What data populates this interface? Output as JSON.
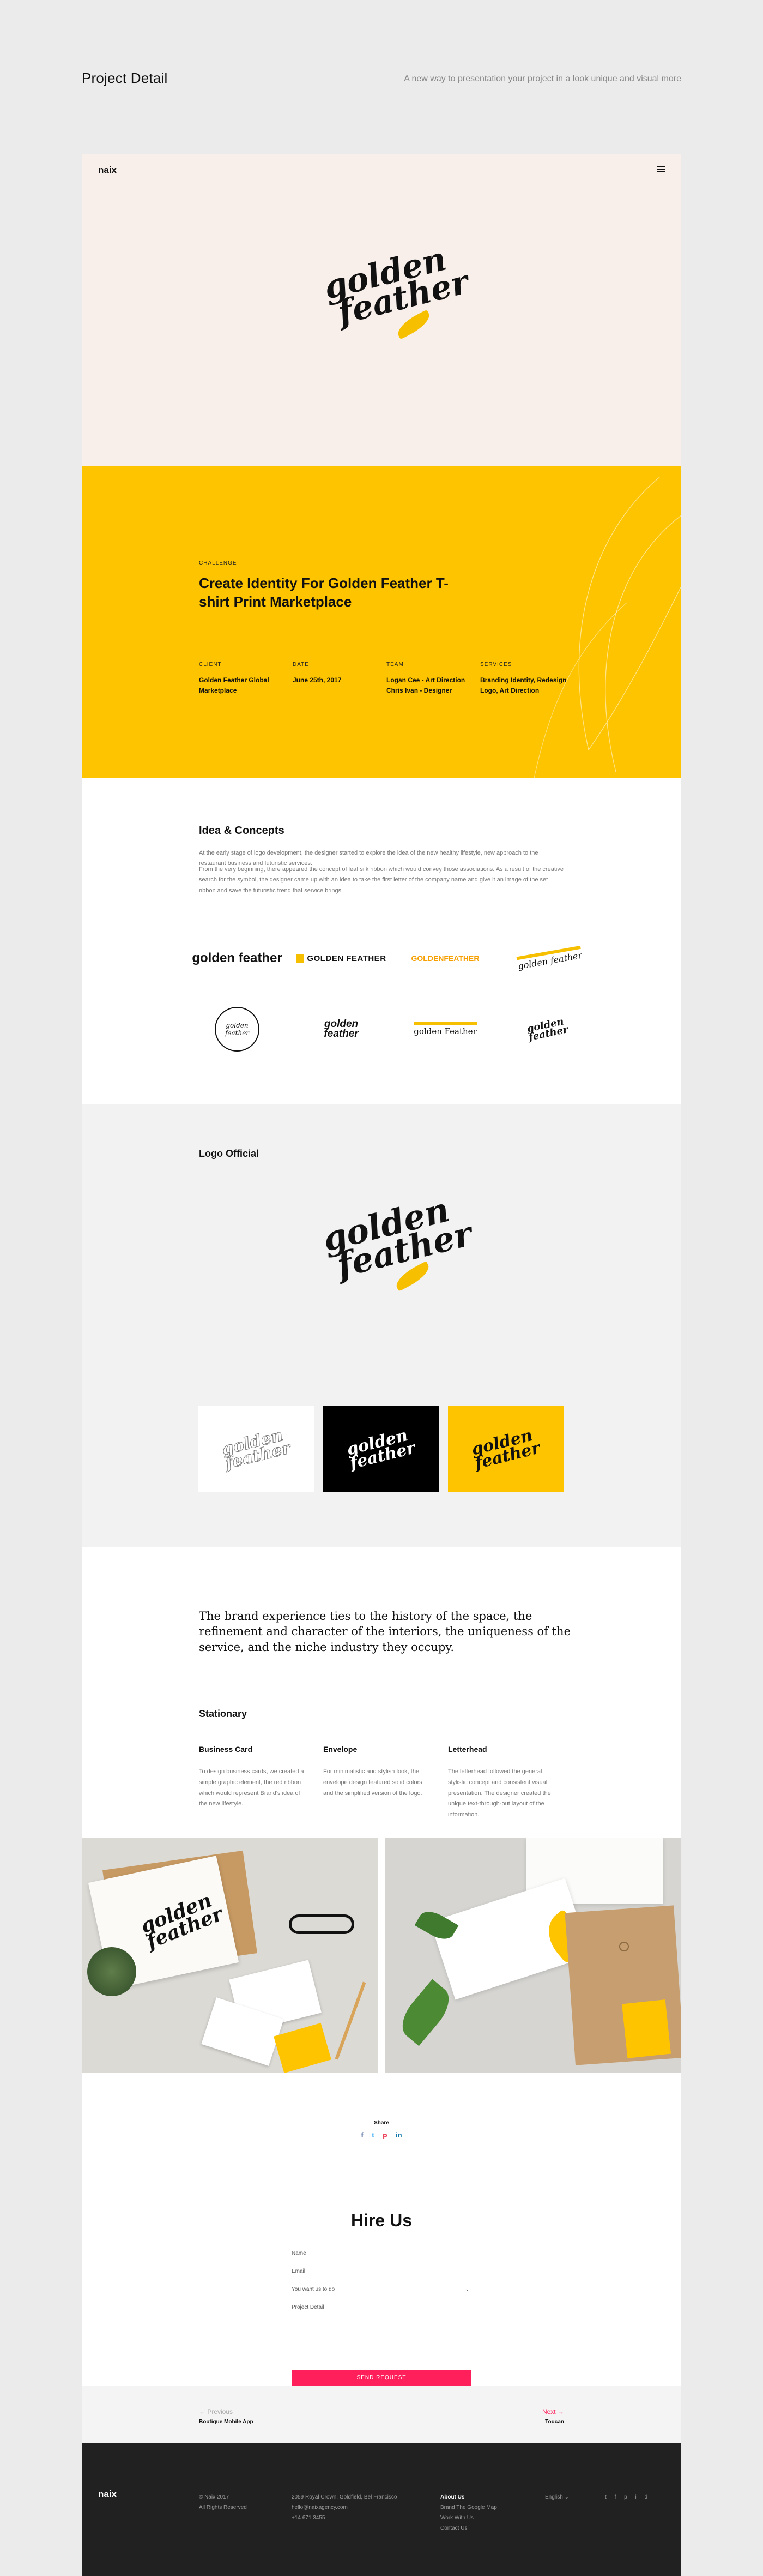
{
  "outer": {
    "title": "Project Detail",
    "tagline": "A new way to presentation your project in a look unique and visual more"
  },
  "nav": {
    "logo": "naix"
  },
  "brand": {
    "line1": "golden",
    "line2": "feather",
    "accent": "#ffc400",
    "feather_color": "#f6c000",
    "hero_bg": "#f9efea",
    "button_color": "#ff1f5a"
  },
  "challenge": {
    "label": "CHALLENGE",
    "title": "Create Identity For Golden Feather T-shirt Print Marketplace",
    "meta": [
      {
        "label": "CLIENT",
        "value": "Golden Feather Global Marketplace"
      },
      {
        "label": "DATE",
        "value": "June 25th, 2017"
      },
      {
        "label": "TEAM",
        "value": "Logan Cee - Art Direction Chris Ivan - Designer"
      },
      {
        "label": "SERVICES",
        "value": "Branding Identity, Redesign Logo, Art Direction"
      }
    ]
  },
  "idea": {
    "title": "Idea & Concepts",
    "p1": "At the early stage of logo development, the designer started to explore the idea of the new healthy lifestyle, new approach to the restaurant business and futuristic services.",
    "p2": "From the very beginning, there appeared the concept of leaf silk ribbon which would convey those associations. As a result of the creative search for the symbol, the designer came up with an idea to take the first letter of the company name and give it an image of the set ribbon and save the futuristic trend that service brings.",
    "concepts": [
      "golden feather",
      "GOLDEN FEATHER",
      "GOLDENFEATHER",
      "golden feather",
      "golden feather",
      "golden feather",
      "golden Feather",
      "golden feather"
    ]
  },
  "official": {
    "title": "Logo Official"
  },
  "quote": {
    "text": "The brand experience ties to the history of the space, the refinement and character of the interiors, the uniqueness of the service, and the niche industry they occupy."
  },
  "stationary": {
    "title": "Stationary",
    "columns": [
      {
        "title": "Business Card",
        "text": "To design business cards, we created a simple graphic element, the red ribbon which would represent Brand's idea of the new lifestyle."
      },
      {
        "title": "Envelope",
        "text": "For minimalistic and stylish look, the envelope design featured solid colors and the simplified version of the logo."
      },
      {
        "title": "Letterhead",
        "text": "The letterhead followed the general stylistic concept and consistent visual presentation. The designer created the unique text-through-out layout of the information."
      }
    ]
  },
  "share": {
    "label": "Share",
    "icons": [
      "f",
      "t",
      "p",
      "in"
    ],
    "colors": [
      "#3b5998",
      "#1da1f2",
      "#e60023",
      "#0e76a8"
    ]
  },
  "hire": {
    "title": "Hire Us",
    "fields": [
      {
        "label": "Name"
      },
      {
        "label": "Email"
      },
      {
        "label": "You want us to do"
      },
      {
        "label": "Project Detail"
      }
    ],
    "submit": "SEND REQUEST"
  },
  "pager": {
    "prev_label": "Previous",
    "prev_title": "Boutique Mobile App",
    "next_label": "Next",
    "next_title": "Toucan"
  },
  "footer": {
    "logo": "naix",
    "copyright": "© Naix 2017",
    "rights": "All Rights Reserved",
    "address": "2059 Royal Crown, Goldfield, Bel Francisco",
    "email": "hello@naixagency.com",
    "phone": "+14 671 3455",
    "links": [
      "About Us",
      "Brand The Google Map",
      "Work With Us",
      "Contact Us"
    ],
    "language": "English",
    "social": [
      "t",
      "f",
      "p",
      "i",
      "d"
    ]
  }
}
